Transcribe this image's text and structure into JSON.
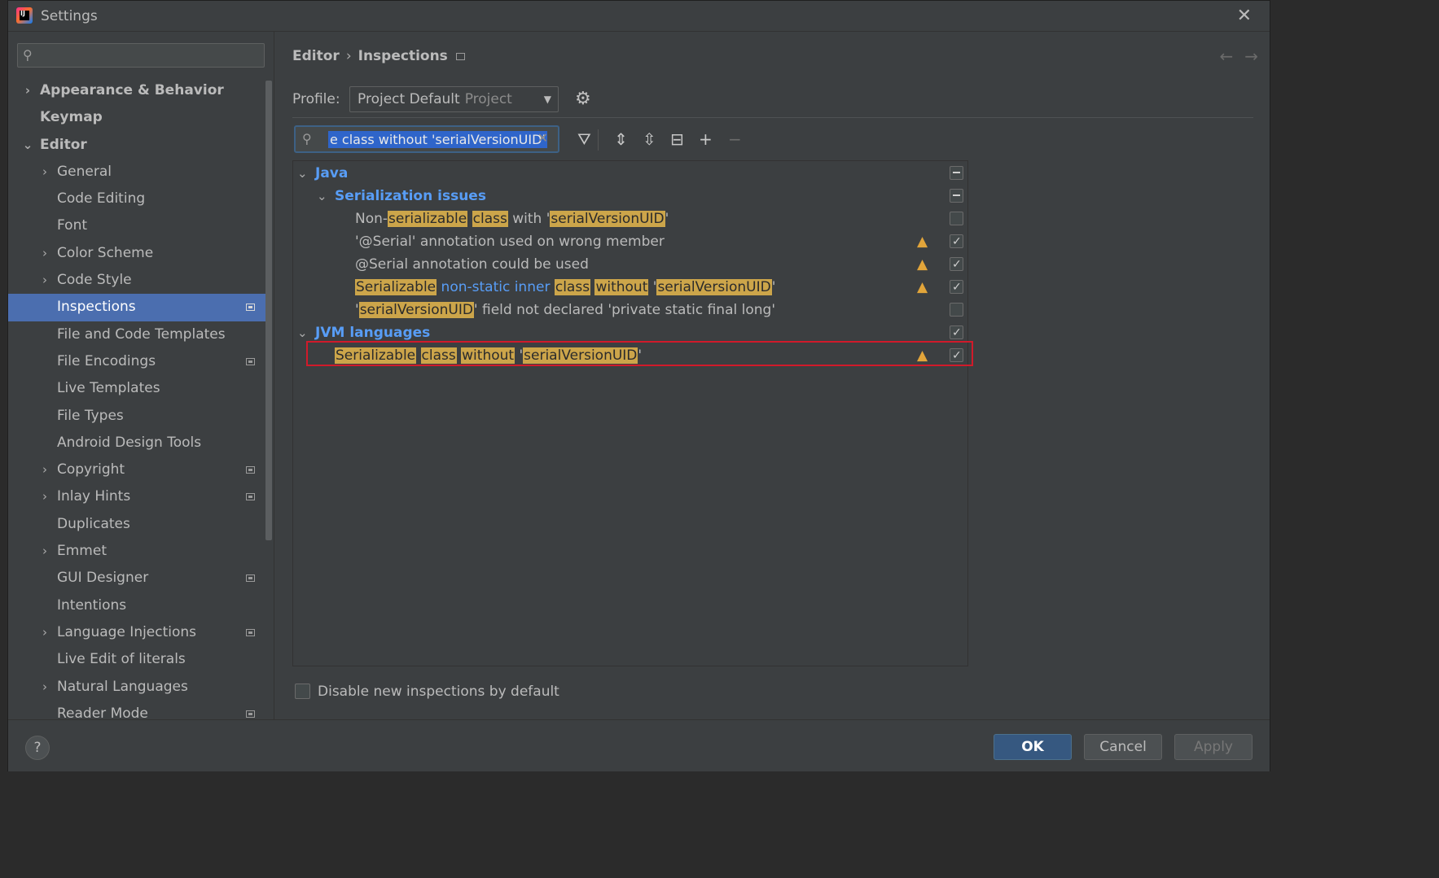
{
  "window": {
    "title": "Settings"
  },
  "sidebar": {
    "items": [
      {
        "label": "Appearance & Behavior",
        "level": 0,
        "expandable": true,
        "expanded": false,
        "bold": true
      },
      {
        "label": "Keymap",
        "level": 0,
        "expandable": false,
        "bold": true
      },
      {
        "label": "Editor",
        "level": 0,
        "expandable": true,
        "expanded": true,
        "bold": true
      },
      {
        "label": "General",
        "level": 1,
        "expandable": true,
        "expanded": false
      },
      {
        "label": "Code Editing",
        "level": 1,
        "expandable": false
      },
      {
        "label": "Font",
        "level": 1,
        "expandable": false
      },
      {
        "label": "Color Scheme",
        "level": 1,
        "expandable": true,
        "expanded": false
      },
      {
        "label": "Code Style",
        "level": 1,
        "expandable": true,
        "expanded": false
      },
      {
        "label": "Inspections",
        "level": 1,
        "expandable": false,
        "selected": true,
        "project": true
      },
      {
        "label": "File and Code Templates",
        "level": 1,
        "expandable": false
      },
      {
        "label": "File Encodings",
        "level": 1,
        "expandable": false,
        "project": true
      },
      {
        "label": "Live Templates",
        "level": 1,
        "expandable": false
      },
      {
        "label": "File Types",
        "level": 1,
        "expandable": false
      },
      {
        "label": "Android Design Tools",
        "level": 1,
        "expandable": false
      },
      {
        "label": "Copyright",
        "level": 1,
        "expandable": true,
        "expanded": false,
        "project": true
      },
      {
        "label": "Inlay Hints",
        "level": 1,
        "expandable": true,
        "expanded": false,
        "project": true
      },
      {
        "label": "Duplicates",
        "level": 1,
        "expandable": false
      },
      {
        "label": "Emmet",
        "level": 1,
        "expandable": true,
        "expanded": false
      },
      {
        "label": "GUI Designer",
        "level": 1,
        "expandable": false,
        "project": true
      },
      {
        "label": "Intentions",
        "level": 1,
        "expandable": false
      },
      {
        "label": "Language Injections",
        "level": 1,
        "expandable": true,
        "expanded": false,
        "project": true
      },
      {
        "label": "Live Edit of literals",
        "level": 1,
        "expandable": false
      },
      {
        "label": "Natural Languages",
        "level": 1,
        "expandable": true,
        "expanded": false
      },
      {
        "label": "Reader Mode",
        "level": 1,
        "expandable": false,
        "project": true
      }
    ]
  },
  "breadcrumb": {
    "parent": "Editor",
    "current": "Inspections"
  },
  "profile": {
    "label": "Profile:",
    "value": "Project Default",
    "scope": "Project"
  },
  "filter": {
    "value": "e class without 'serialVersionUID'"
  },
  "colors": {
    "accent": "#4b6eaf",
    "group": "#589df6",
    "highlight": "#cca54a",
    "warning": "#e2a53a",
    "redbox": "#d11a2a"
  },
  "tree": {
    "java": {
      "label": "Java",
      "serialization_group": "Serialization issues",
      "rows": [
        {
          "parts": [
            {
              "t": "Non-",
              "s": "n"
            },
            {
              "t": "serializable",
              "s": "h"
            },
            {
              "t": " ",
              "s": "n"
            },
            {
              "t": "class",
              "s": "h"
            },
            {
              "t": " with '",
              "s": "n"
            },
            {
              "t": "serialVersionUID",
              "s": "h"
            },
            {
              "t": "'",
              "s": "n"
            }
          ],
          "warning": false,
          "checked": false
        },
        {
          "parts": [
            {
              "t": "'@Serial' annotation used on wrong member",
              "s": "n"
            }
          ],
          "warning": true,
          "checked": true
        },
        {
          "parts": [
            {
              "t": "@Serial annotation could be used",
              "s": "n"
            }
          ],
          "warning": true,
          "checked": true
        },
        {
          "parts": [
            {
              "t": "Serializable",
              "s": "h"
            },
            {
              "t": " ",
              "s": "n"
            },
            {
              "t": "non-static inner",
              "s": "b"
            },
            {
              "t": " ",
              "s": "n"
            },
            {
              "t": "class",
              "s": "h"
            },
            {
              "t": " ",
              "s": "n"
            },
            {
              "t": "without",
              "s": "h"
            },
            {
              "t": " '",
              "s": "n"
            },
            {
              "t": "serialVersionUID",
              "s": "h"
            },
            {
              "t": "'",
              "s": "n"
            }
          ],
          "warning": true,
          "checked": true
        },
        {
          "parts": [
            {
              "t": "'",
              "s": "n"
            },
            {
              "t": "serialVersionUID",
              "s": "h"
            },
            {
              "t": "' field not declared 'private static final long'",
              "s": "n"
            }
          ],
          "warning": false,
          "checked": false
        }
      ]
    },
    "jvm": {
      "label": "JVM languages",
      "rows": [
        {
          "parts": [
            {
              "t": "Serializable",
              "s": "h"
            },
            {
              "t": " ",
              "s": "n"
            },
            {
              "t": "class",
              "s": "h"
            },
            {
              "t": " ",
              "s": "n"
            },
            {
              "t": "without",
              "s": "h"
            },
            {
              "t": " '",
              "s": "n"
            },
            {
              "t": "serialVersionUID",
              "s": "h"
            },
            {
              "t": "'",
              "s": "n"
            }
          ],
          "warning": true,
          "checked": true
        }
      ]
    }
  },
  "footer": {
    "disable_label": "Disable new inspections by default"
  },
  "buttons": {
    "help": "?",
    "ok": "OK",
    "cancel": "Cancel",
    "apply": "Apply"
  }
}
